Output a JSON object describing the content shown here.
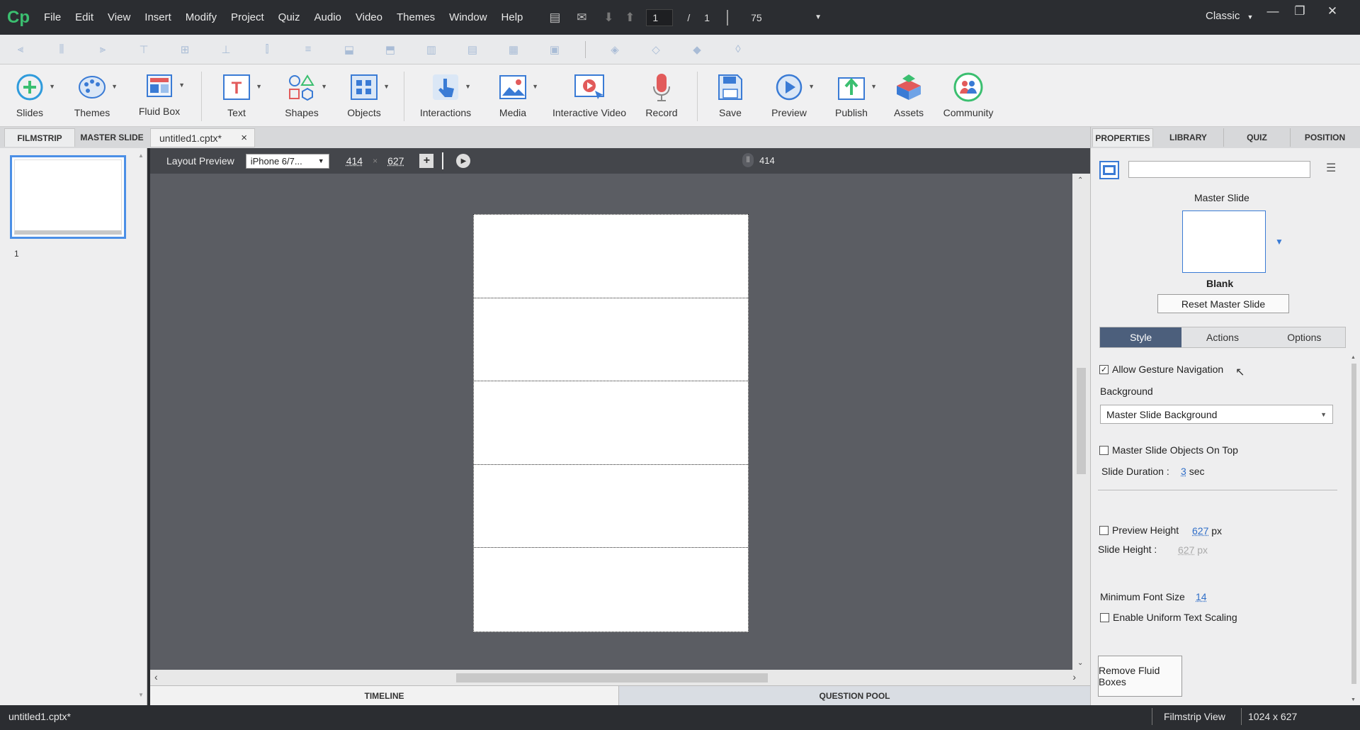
{
  "app": {
    "logo": "Cp",
    "workspace": "Classic"
  },
  "menu": [
    "File",
    "Edit",
    "View",
    "Insert",
    "Modify",
    "Project",
    "Quiz",
    "Audio",
    "Video",
    "Themes",
    "Window",
    "Help"
  ],
  "nav": {
    "current_slide": "1",
    "separator": "/",
    "total_slides": "1",
    "zoom": "75"
  },
  "toolbar": [
    {
      "label": "Slides",
      "icon": "plus-circle-icon"
    },
    {
      "label": "Themes",
      "icon": "palette-icon"
    },
    {
      "label": "Fluid Box",
      "icon": "fluid-box-icon"
    },
    {
      "label": "Text",
      "icon": "text-icon"
    },
    {
      "label": "Shapes",
      "icon": "shapes-icon"
    },
    {
      "label": "Objects",
      "icon": "objects-icon"
    },
    {
      "label": "Interactions",
      "icon": "hand-pointer-icon"
    },
    {
      "label": "Media",
      "icon": "image-icon"
    },
    {
      "label": "Interactive Video",
      "icon": "interactive-video-icon"
    },
    {
      "label": "Record",
      "icon": "microphone-icon"
    },
    {
      "label": "Save",
      "icon": "save-icon"
    },
    {
      "label": "Preview",
      "icon": "play-circle-icon"
    },
    {
      "label": "Publish",
      "icon": "publish-icon"
    },
    {
      "label": "Assets",
      "icon": "assets-icon"
    },
    {
      "label": "Community",
      "icon": "community-icon"
    }
  ],
  "left_tabs": {
    "filmstrip": "FILMSTRIP",
    "master_slide": "MASTER SLIDE"
  },
  "document_tab": {
    "name": "untitled1.cptx*",
    "close": "×"
  },
  "filmstrip": {
    "slide_number": "1"
  },
  "stage_bar": {
    "layout_preview_label": "Layout Preview",
    "device": "iPhone 6/7...",
    "width": "414",
    "times": "×",
    "height": "627",
    "ruler_marker": "414"
  },
  "canvas": {
    "fluid_rows": 5
  },
  "bottom_tabs": {
    "timeline": "TIMELINE",
    "question_pool": "QUESTION POOL"
  },
  "properties": {
    "tabs": [
      "PROPERTIES",
      "LIBRARY",
      "QUIZ",
      "POSITION"
    ],
    "name_value": "",
    "master_slide_label": "Master Slide",
    "master_slide_name": "Blank",
    "reset_button": "Reset Master Slide",
    "segments": [
      "Style",
      "Actions",
      "Options"
    ],
    "allow_gesture_navigation": "Allow Gesture Navigation",
    "background_label": "Background",
    "background_value": "Master Slide Background",
    "master_objects_on_top": "Master Slide Objects On Top",
    "slide_duration_label": "Slide Duration :",
    "slide_duration_value": "3",
    "slide_duration_unit": "sec",
    "preview_height_label": "Preview Height",
    "preview_height_value": "627",
    "px": "px",
    "slide_height_label": "Slide Height :",
    "slide_height_value": "627",
    "min_font_label": "Minimum Font Size",
    "min_font_value": "14",
    "uniform_text_scaling": "Enable Uniform Text Scaling",
    "remove_fluid_boxes": "Remove Fluid Boxes"
  },
  "status": {
    "file": "untitled1.cptx*",
    "view": "Filmstrip View",
    "resolution": "1024 x 627"
  },
  "colors": {
    "accent_blue": "#4b8fe6",
    "logo_green": "#3bbf70",
    "segment_active": "#4c5f7c",
    "stage_bg": "#5b5d63"
  }
}
